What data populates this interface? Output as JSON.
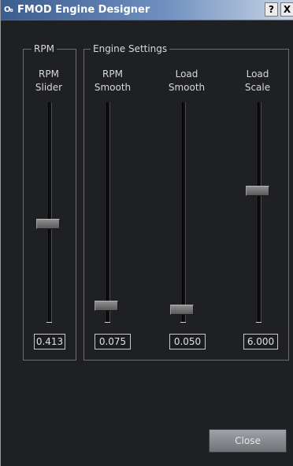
{
  "window": {
    "title": "FMOD Engine Designer",
    "icon_text": "O₈",
    "help_label": "?",
    "close_label": "X"
  },
  "rpm_group": {
    "legend": "RPM",
    "slider": {
      "label_line1": "RPM",
      "label_line2": "Slider",
      "value": "0.413",
      "position_fraction": 0.55
    }
  },
  "engine_group": {
    "legend": "Engine Settings",
    "sliders": [
      {
        "label_line1": "RPM",
        "label_line2": "Smooth",
        "value": "0.075",
        "position_fraction": 0.92
      },
      {
        "label_line1": "Load",
        "label_line2": "Smooth",
        "value": "0.050",
        "position_fraction": 0.94
      },
      {
        "label_line1": "Load",
        "label_line2": "Scale",
        "value": "6.000",
        "position_fraction": 0.4
      }
    ]
  },
  "footer": {
    "close_button_label": "Close"
  }
}
